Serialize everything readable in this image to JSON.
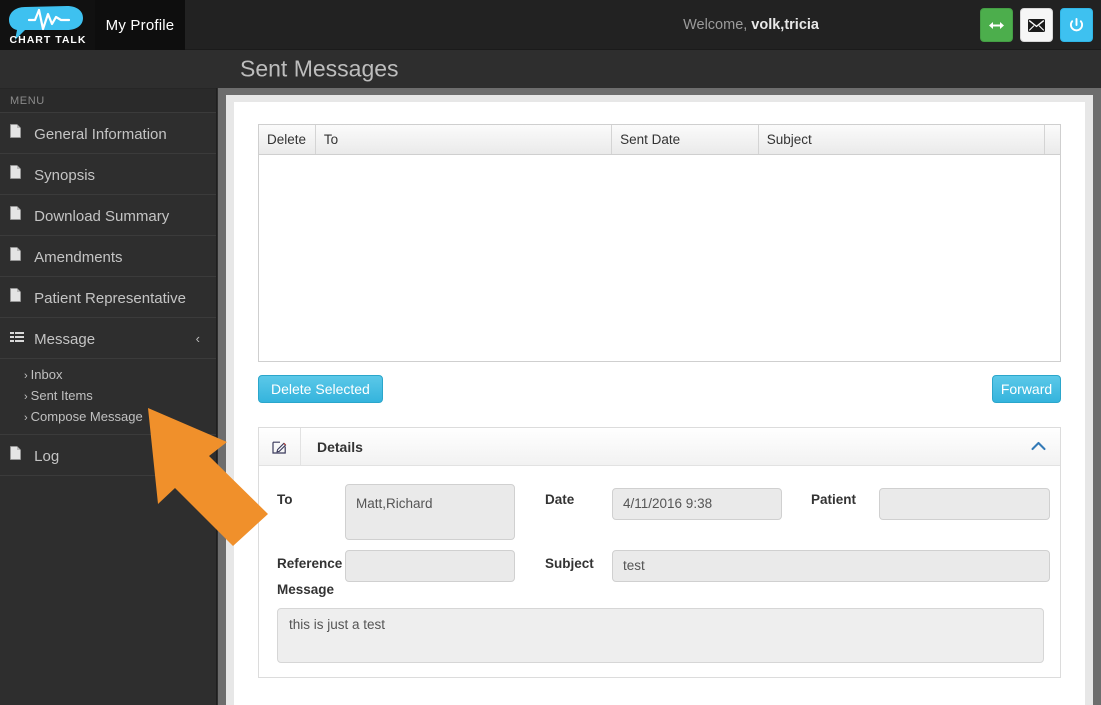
{
  "topnav": {
    "logo_text": "CHART TALK",
    "logo_name": "chart-talk-logo",
    "profile_tab": "My Profile",
    "welcome_prefix": "Welcome,",
    "user_name": "volk,tricia",
    "buttons": [
      {
        "name": "resize-toggle-button",
        "icon": "arrows-h-icon",
        "color": "#4cae4c"
      },
      {
        "name": "messages-button",
        "icon": "envelope-icon",
        "color": "#f6f6f6"
      },
      {
        "name": "logout-button",
        "icon": "power-icon",
        "color": "#3ec1f0"
      }
    ]
  },
  "page": {
    "title": "Sent Messages"
  },
  "sidebar": {
    "header": "MENU",
    "items": [
      {
        "label": "General Information",
        "icon": "file-icon",
        "expandable": false
      },
      {
        "label": "Synopsis",
        "icon": "file-icon",
        "expandable": false
      },
      {
        "label": "Download Summary",
        "icon": "file-icon",
        "expandable": false
      },
      {
        "label": "Amendments",
        "icon": "file-icon",
        "expandable": false
      },
      {
        "label": "Patient Representative",
        "icon": "file-icon",
        "expandable": false
      },
      {
        "label": "Message",
        "icon": "list-icon",
        "expandable": true,
        "caret": "‹"
      },
      {
        "label": "Log",
        "icon": "file-icon",
        "expandable": false
      }
    ],
    "submenu": [
      {
        "label": "Inbox",
        "arrow": "›"
      },
      {
        "label": "Sent Items",
        "arrow": "›"
      },
      {
        "label": "Compose Message",
        "arrow": "›"
      }
    ]
  },
  "grid": {
    "columns": [
      "Delete",
      "To",
      "Sent Date",
      "Subject"
    ],
    "rows": []
  },
  "actions": {
    "delete_selected": "Delete Selected",
    "forward": "Forward"
  },
  "details": {
    "title": "Details",
    "icon": "edit-pencil-icon",
    "collapse_icon": "chevron-up-icon",
    "fields": {
      "to_label": "To",
      "to_value": "Matt,Richard",
      "date_label": "Date",
      "date_value": "4/11/2016 9:38",
      "patient_label": "Patient",
      "patient_value": "",
      "reference_label": "Reference",
      "reference_value": "",
      "subject_label": "Subject",
      "subject_value": "test",
      "message_label": "Message",
      "message_value": "this is just a test"
    }
  },
  "overlay": {
    "arrow_name": "annotation-arrow",
    "arrow_color": "#F0902B",
    "points_to": "Compose Message"
  },
  "colors": {
    "accent_blue": "#35b4dd",
    "nav_dark": "#222222",
    "sidebar_dark": "#2e2e2e",
    "logo_cyan": "#3ec1f0"
  }
}
